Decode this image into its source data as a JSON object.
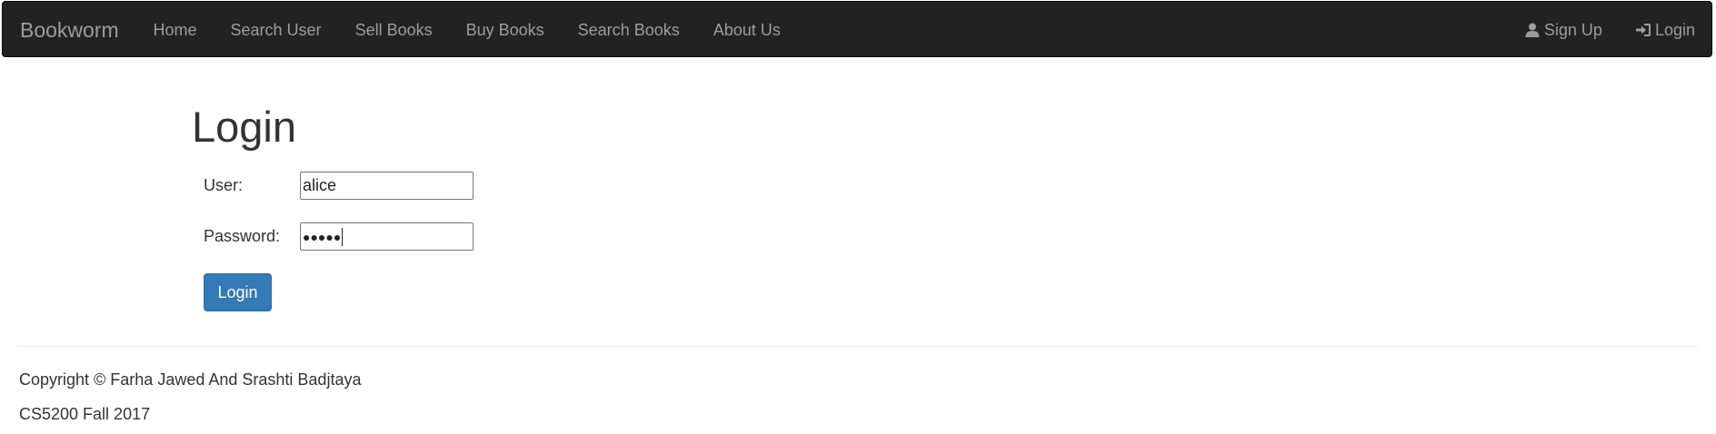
{
  "navbar": {
    "brand": "Bookworm",
    "items": [
      {
        "label": "Home"
      },
      {
        "label": "Search User"
      },
      {
        "label": "Sell Books"
      },
      {
        "label": "Buy Books"
      },
      {
        "label": "Search Books"
      },
      {
        "label": "About Us"
      }
    ],
    "right_items": [
      {
        "label": "Sign Up",
        "icon": "user-icon"
      },
      {
        "label": "Login",
        "icon": "log-in-icon"
      }
    ],
    "background_color": "#222222",
    "text_color": "#9d9d9d"
  },
  "page": {
    "title": "Login"
  },
  "form": {
    "user_label": "User:",
    "user_value": "alice",
    "password_label": "Password:",
    "password_masked": "●●●●●",
    "submit_label": "Login",
    "submit_color": "#337ab7"
  },
  "footer": {
    "copyright": "Copyright © Farha Jawed And Srashti Badjtaya",
    "course": "CS5200 Fall 2017"
  }
}
